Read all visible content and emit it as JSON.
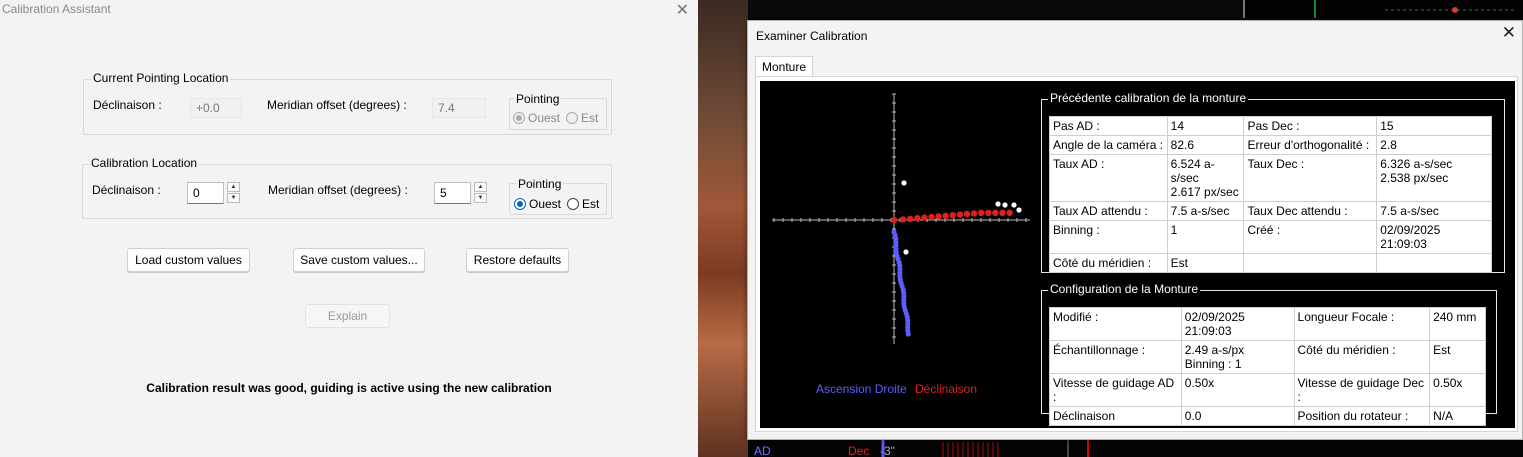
{
  "calibration_assistant": {
    "title": "Calibration Assistant",
    "current_pointing": {
      "group_title": "Current Pointing Location",
      "declination_label": "Déclinaison :",
      "declination_value": "+0.0",
      "meridian_label": "Meridian offset (degrees) :",
      "meridian_value": "7.4",
      "pointing_title": "Pointing",
      "west_label": "Ouest",
      "east_label": "Est",
      "selected": "Ouest"
    },
    "calibration_location": {
      "group_title": "Calibration Location",
      "declination_label": "Déclinaison :",
      "declination_value": "0",
      "meridian_label": "Meridian offset (degrees) :",
      "meridian_value": "5",
      "pointing_title": "Pointing",
      "west_label": "Ouest",
      "east_label": "Est",
      "selected": "Ouest"
    },
    "buttons": {
      "load": "Load custom values",
      "save": "Save custom values...",
      "restore": "Restore defaults",
      "explain": "Explain"
    },
    "result_message": "Calibration result was good, guiding is active using the new calibration"
  },
  "examiner": {
    "title": "Examiner Calibration",
    "tab_label": "Monture",
    "legend": {
      "ad": "Ascension Droite",
      "dec": "Déclinaison",
      "ad_color": "#5c5cff",
      "dec_color": "#e02020"
    },
    "previous_calibration": {
      "title": "Précédente calibration de la monture",
      "rows": [
        {
          "k1": "Pas AD :",
          "v1": "14",
          "k2": "Pas Dec :",
          "v2": "15"
        },
        {
          "k1": "Angle de la caméra :",
          "v1": "82.6",
          "k2": "Erreur d'orthogonalité :",
          "v2": "2.8"
        },
        {
          "k1": "Taux AD :",
          "v1a": "6.524 a-s/sec",
          "v1b": "2.617 px/sec",
          "k2": "Taux Dec :",
          "v2a": "6.326 a-s/sec",
          "v2b": "2.538 px/sec"
        },
        {
          "k1": "Taux AD attendu :",
          "v1": "7.5 a-s/sec",
          "k2": "Taux Dec attendu :",
          "v2": "7.5 a-s/sec"
        },
        {
          "k1": "Binning :",
          "v1": "1",
          "k2": "Créé :",
          "v2": "02/09/2025 21:09:03"
        },
        {
          "k1": "Côté du méridien :",
          "v1": "Est",
          "k2": "",
          "v2": ""
        }
      ]
    },
    "mount_config": {
      "title": "Configuration de la Monture",
      "rows": [
        {
          "k1": "Modifié :",
          "v1": "02/09/2025 21:09:03",
          "k2": "Longueur Focale :",
          "v2": "240 mm"
        },
        {
          "k1": "Échantillonnage :",
          "v1a": "2.49 a-s/px",
          "v1b": "Binning : 1",
          "k2": "Côté du méridien :",
          "v2": "Est"
        },
        {
          "k1": "Vitesse de guidage AD :",
          "v1": "0.50x",
          "k2": "Vitesse de guidage Dec :",
          "v2": "0.50x"
        },
        {
          "k1": "Déclinaison",
          "v1": "0.0",
          "k2": "Position du rotateur :",
          "v2": "N/A"
        }
      ]
    }
  },
  "background": {
    "ad_label": "AD",
    "dec_label": "Dec",
    "value_label": "-3\""
  }
}
